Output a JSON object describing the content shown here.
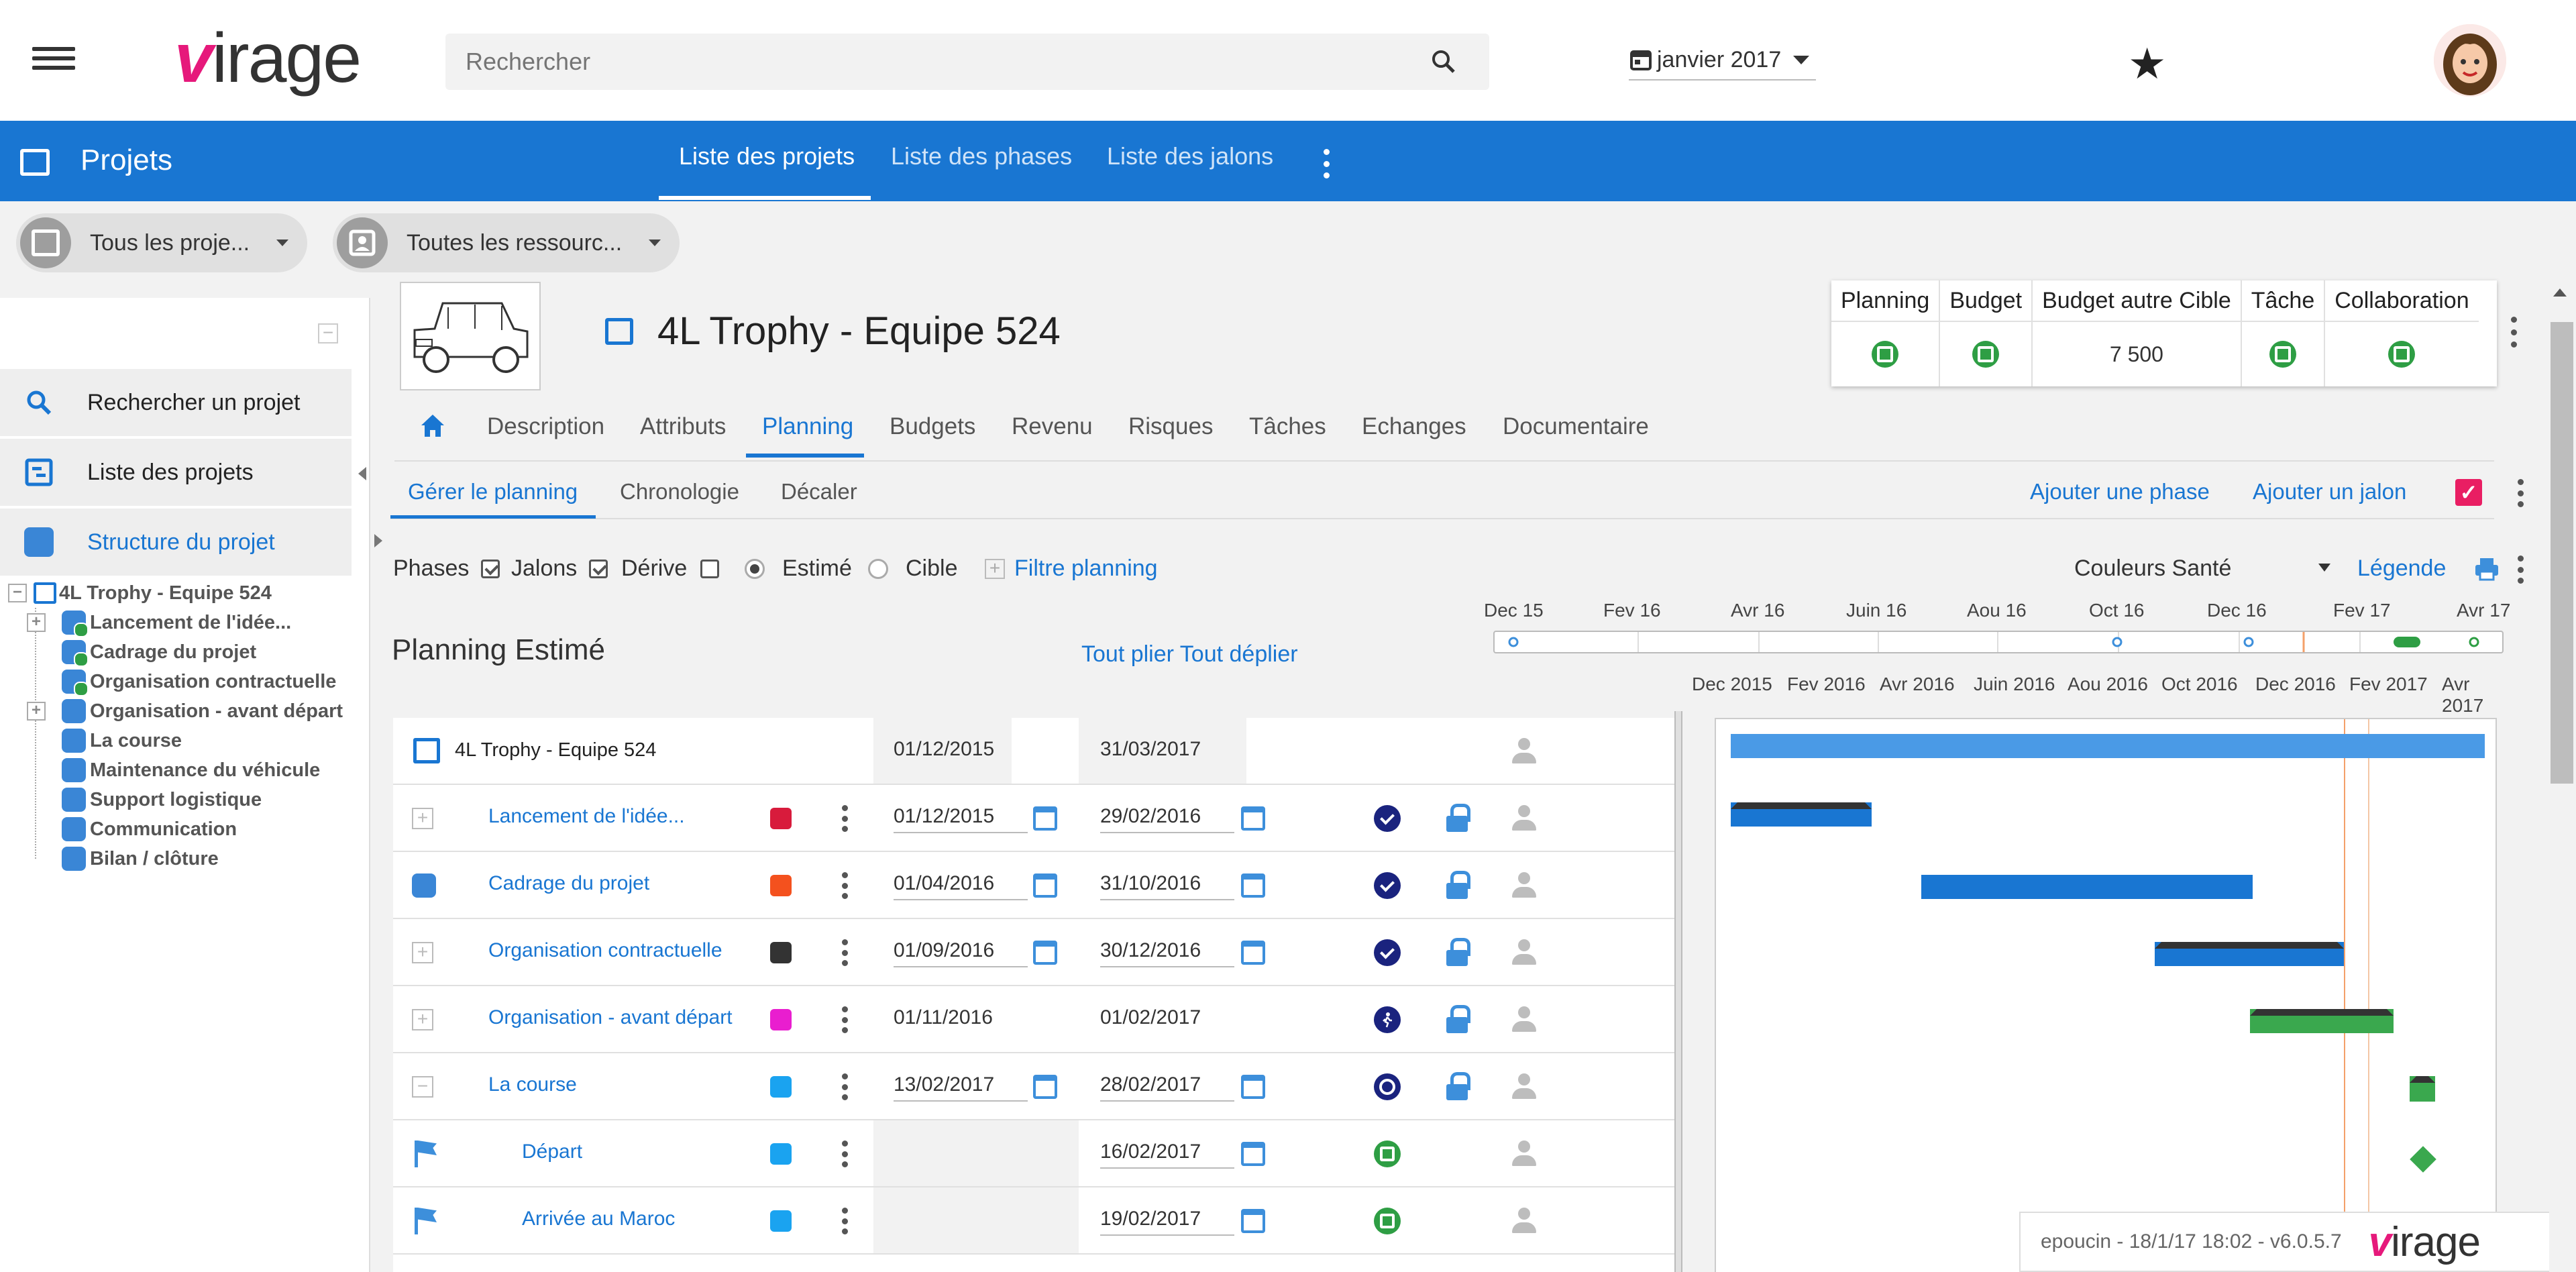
{
  "app": {
    "logo_rest": "irage",
    "logo_v": "v"
  },
  "search": {
    "placeholder": "Rechercher"
  },
  "date_selector": {
    "value": "janvier 2017"
  },
  "module": {
    "title": "Projets",
    "tabs": [
      {
        "label": "Liste des projets",
        "active": true
      },
      {
        "label": "Liste des phases",
        "active": false
      },
      {
        "label": "Liste des jalons",
        "active": false
      }
    ]
  },
  "filters": {
    "projects": "Tous les proje...",
    "resources": "Toutes les ressourc..."
  },
  "sidebar": {
    "buttons": [
      {
        "label": "Rechercher un projet"
      },
      {
        "label": "Liste des projets"
      },
      {
        "label": "Structure du projet"
      }
    ],
    "tree_root": "4L Trophy - Equipe 524",
    "tree": [
      {
        "label": "Lancement de l'idée...",
        "expandable": true,
        "ok": true
      },
      {
        "label": "Cadrage du projet",
        "expandable": false,
        "ok": true
      },
      {
        "label": "Organisation contractuelle",
        "expandable": false,
        "ok": true
      },
      {
        "label": "Organisation - avant départ",
        "expandable": true,
        "ok": false
      },
      {
        "label": "La course",
        "expandable": false,
        "ok": false
      },
      {
        "label": "Maintenance du véhicule",
        "expandable": false,
        "ok": false
      },
      {
        "label": "Support logistique",
        "expandable": false,
        "ok": false
      },
      {
        "label": "Communication",
        "expandable": false,
        "ok": false
      },
      {
        "label": "Bilan / clôture",
        "expandable": false,
        "ok": false
      }
    ]
  },
  "project": {
    "name": "4L Trophy - Equipe 524",
    "kpi": {
      "headers": [
        "Planning",
        "Budget",
        "Budget autre Cible",
        "Tâche",
        "Collaboration"
      ],
      "budget_autre_cible": "7 500"
    },
    "tabs": [
      "Description",
      "Attributs",
      "Planning",
      "Budgets",
      "Revenu",
      "Risques",
      "Tâches",
      "Echanges",
      "Documentaire"
    ],
    "active_tab": "Planning",
    "subtabs": [
      "Gérer le planning",
      "Chronologie",
      "Décaler"
    ],
    "actions": [
      "Ajouter une phase",
      "Ajouter un jalon"
    ]
  },
  "options": {
    "phases": "Phases",
    "jalons": "Jalons",
    "derive": "Dérive",
    "estime": "Estimé",
    "cible": "Cible",
    "filtre": "Filtre planning",
    "couleurs": "Couleurs Santé",
    "legende": "Légende"
  },
  "planning": {
    "title": "Planning Estimé",
    "fold": "Tout plier Tout déplier",
    "minimap_ticks": [
      "Dec 15",
      "Fev 16",
      "Avr 16",
      "Juin 16",
      "Aou 16",
      "Oct 16",
      "Dec 16",
      "Fev 17",
      "Avr 17"
    ],
    "gantt_ticks": [
      "Dec 2015",
      "Fev 2016",
      "Avr 2016",
      "Juin 2016",
      "Aou 2016",
      "Oct 2016",
      "Dec 2016",
      "Fev 2017",
      "Avr 2017"
    ],
    "rows": [
      {
        "name": "4L Trophy - Equipe 524",
        "start": "01/12/2015",
        "end": "31/03/2017",
        "color": "",
        "status": "",
        "type": "project"
      },
      {
        "name": "Lancement de l'idée...",
        "start": "01/12/2015",
        "end": "29/02/2016",
        "color": "#d81b3c",
        "status": "check",
        "type": "phase-plus"
      },
      {
        "name": "Cadrage du projet",
        "start": "01/04/2016",
        "end": "31/10/2016",
        "color": "#f4511e",
        "status": "check",
        "type": "phase-puzzle"
      },
      {
        "name": "Organisation contractuelle",
        "start": "01/09/2016",
        "end": "30/12/2016",
        "color": "#333333",
        "status": "check",
        "type": "phase-plus"
      },
      {
        "name": "Organisation - avant départ",
        "start": "01/11/2016",
        "end": "01/02/2017",
        "color": "#e91ecf",
        "status": "walk",
        "type": "phase-plus"
      },
      {
        "name": "La course",
        "start": "13/02/2017",
        "end": "28/02/2017",
        "color": "#1aa3f0",
        "status": "power",
        "type": "phase-minus"
      },
      {
        "name": "Départ",
        "start": "",
        "end": "16/02/2017",
        "color": "#1aa3f0",
        "status": "green",
        "type": "milestone"
      },
      {
        "name": "Arrivée au Maroc",
        "start": "",
        "end": "19/02/2017",
        "color": "#1aa3f0",
        "status": "green",
        "type": "milestone"
      }
    ]
  },
  "footer": {
    "text": "epoucin - 18/1/17 18:02 - v6.0.5.7"
  }
}
